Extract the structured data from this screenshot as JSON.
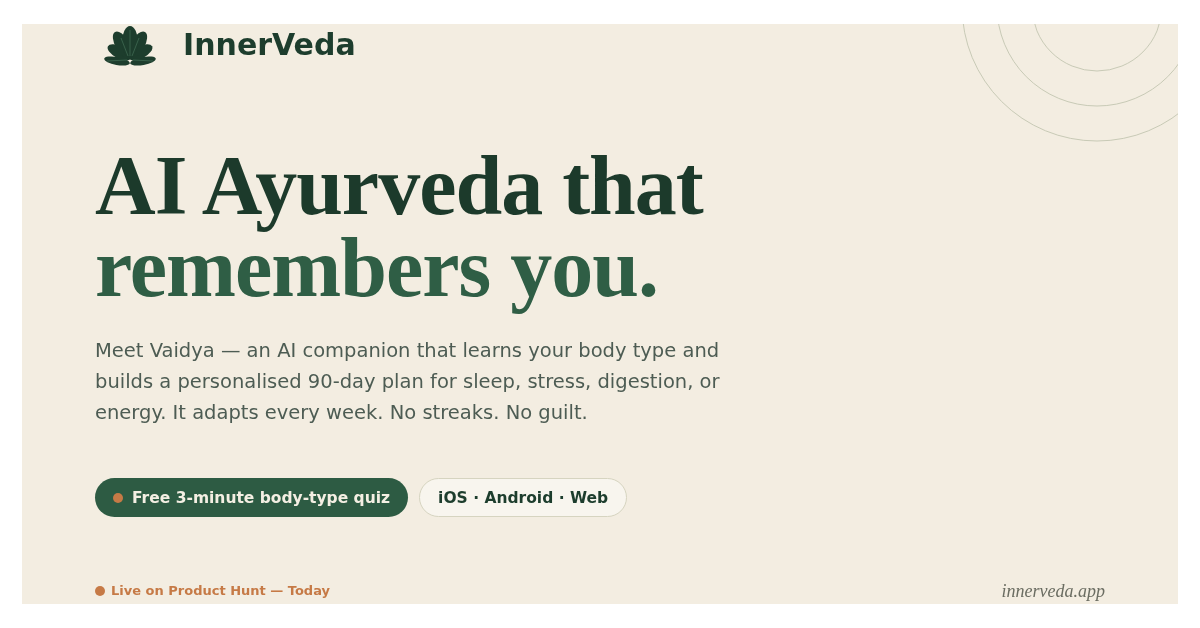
{
  "brand": {
    "name": "InnerVeda"
  },
  "hero": {
    "headline": [
      {
        "text": "AI Ayurveda that",
        "kind": "primary"
      },
      {
        "text": "remembers you.",
        "kind": "accent"
      }
    ],
    "description": "Meet Vaidya — an AI companion that learns your body type and builds a personalised 90-day plan for sleep, stress, digestion, or energy. It adapts every week. No streaks. No guilt.",
    "actions": [
      {
        "label": "Free 3-minute body-type quiz",
        "kind": "primary"
      },
      {
        "label": "iOS · Android · Web",
        "kind": "platforms"
      }
    ]
  },
  "footer": {
    "status": "Live on Product Hunt — Today",
    "site": "innerveda.app"
  }
}
